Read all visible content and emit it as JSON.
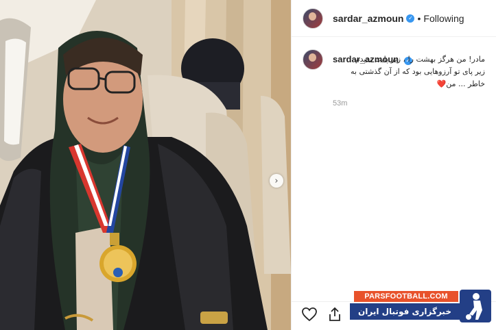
{
  "post": {
    "username": "sardar_azmoun",
    "verified_mark": "✓",
    "separator": "•",
    "follow_state": "Following"
  },
  "comment": {
    "username": "sardar_azmoun",
    "caption": "مادر! من هرگز بهشت را ، زیر پایت ندیدم\nزیر پای تو آرزوهایی بود که از آن گذشتی به خاطر ... من",
    "heart": "❤️",
    "timestamp": "53m"
  },
  "watermark": {
    "site": "PARSFOOTBALL.COM",
    "tagline": "خبرگزاری فوتبال ایران"
  },
  "icons": {
    "next": "chevron-right-icon",
    "like": "heart-outline-icon",
    "share": "share-icon",
    "verified": "verified-badge-icon"
  },
  "colors": {
    "verified": "#3897f0",
    "watermark_orange": "#e8522b",
    "watermark_blue": "#233f86"
  }
}
